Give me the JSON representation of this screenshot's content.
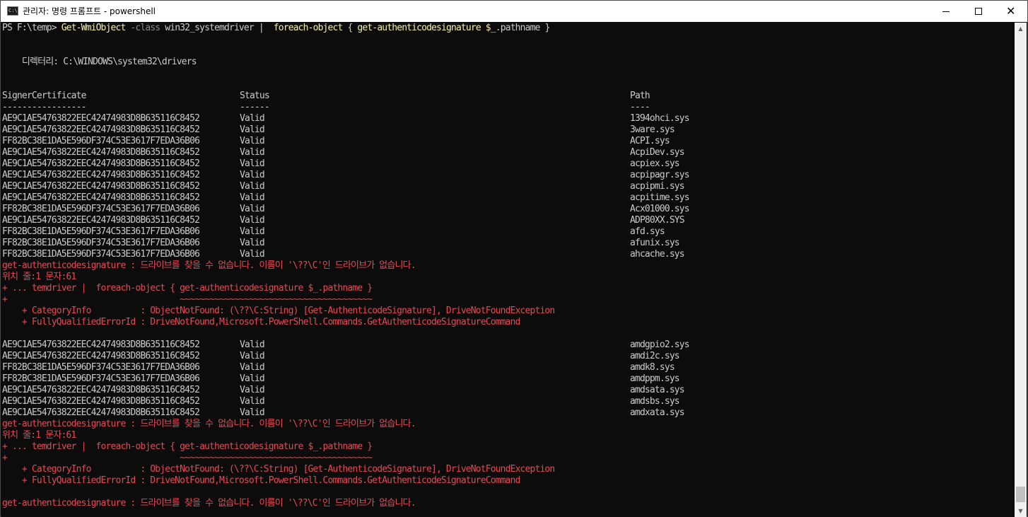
{
  "window": {
    "title": "관리자: 명령 프롬프트 - powershell",
    "icon_text": "C:\\",
    "controls": {
      "minimize": "minimize",
      "maximize": "maximize",
      "close": "✕"
    }
  },
  "console": {
    "prompt": "PS F:\\temp> ",
    "command_part1": "Get-WmiObject",
    "command_param": " -class ",
    "command_part2": "win32_systemdriver",
    "command_pipe": " |  ",
    "command_part3": "foreach-object",
    "command_part4": " { ",
    "command_part5": "get-authenticodesignature",
    "command_var": " $_",
    "command_part6": ".pathname }",
    "directory_line": "    디렉터리: C:\\WINDOWS\\system32\\drivers",
    "headers": {
      "cert": "SignerCertificate",
      "status": "Status",
      "path": "Path"
    },
    "underlines": {
      "cert": "-----------------",
      "status": "------",
      "path": "----"
    },
    "rows_a": [
      {
        "cert": "AE9C1AE54763822EEC42474983D8B635116C8452",
        "status": "Valid",
        "path": "1394ohci.sys"
      },
      {
        "cert": "AE9C1AE54763822EEC42474983D8B635116C8452",
        "status": "Valid",
        "path": "3ware.sys"
      },
      {
        "cert": "FF82BC38E1DA5E596DF374C53E3617F7EDA36B06",
        "status": "Valid",
        "path": "ACPI.sys"
      },
      {
        "cert": "AE9C1AE54763822EEC42474983D8B635116C8452",
        "status": "Valid",
        "path": "AcpiDev.sys"
      },
      {
        "cert": "AE9C1AE54763822EEC42474983D8B635116C8452",
        "status": "Valid",
        "path": "acpiex.sys"
      },
      {
        "cert": "AE9C1AE54763822EEC42474983D8B635116C8452",
        "status": "Valid",
        "path": "acpipagr.sys"
      },
      {
        "cert": "AE9C1AE54763822EEC42474983D8B635116C8452",
        "status": "Valid",
        "path": "acpipmi.sys"
      },
      {
        "cert": "AE9C1AE54763822EEC42474983D8B635116C8452",
        "status": "Valid",
        "path": "acpitime.sys"
      },
      {
        "cert": "FF82BC38E1DA5E596DF374C53E3617F7EDA36B06",
        "status": "Valid",
        "path": "Acx01000.sys"
      },
      {
        "cert": "AE9C1AE54763822EEC42474983D8B635116C8452",
        "status": "Valid",
        "path": "ADP80XX.SYS"
      },
      {
        "cert": "FF82BC38E1DA5E596DF374C53E3617F7EDA36B06",
        "status": "Valid",
        "path": "afd.sys"
      },
      {
        "cert": "FF82BC38E1DA5E596DF374C53E3617F7EDA36B06",
        "status": "Valid",
        "path": "afunix.sys"
      },
      {
        "cert": "FF82BC38E1DA5E596DF374C53E3617F7EDA36B06",
        "status": "Valid",
        "path": "ahcache.sys"
      }
    ],
    "error1": {
      "line1": "get-authenticodesignature : 드라이브를 찾을 수 없습니다. 이름이 '\\??\\C'인 드라이브가 없습니다.",
      "line2": "위치 줄:1 문자:61",
      "line3": "+ ... temdriver |  foreach-object { get-authenticodesignature $_.pathname }",
      "line4": "+                                   ~~~~~~~~~~~~~~~~~~~~~~~~~~~~~~~~~~~~~~~",
      "line5": "    + CategoryInfo          : ObjectNotFound: (\\??\\C:String) [Get-AuthenticodeSignature], DriveNotFoundException",
      "line6": "    + FullyQualifiedErrorId : DriveNotFound,Microsoft.PowerShell.Commands.GetAuthenticodeSignatureCommand"
    },
    "rows_b": [
      {
        "cert": "AE9C1AE54763822EEC42474983D8B635116C8452",
        "status": "Valid",
        "path": "amdgpio2.sys"
      },
      {
        "cert": "AE9C1AE54763822EEC42474983D8B635116C8452",
        "status": "Valid",
        "path": "amdi2c.sys"
      },
      {
        "cert": "FF82BC38E1DA5E596DF374C53E3617F7EDA36B06",
        "status": "Valid",
        "path": "amdk8.sys"
      },
      {
        "cert": "FF82BC38E1DA5E596DF374C53E3617F7EDA36B06",
        "status": "Valid",
        "path": "amdppm.sys"
      },
      {
        "cert": "AE9C1AE54763822EEC42474983D8B635116C8452",
        "status": "Valid",
        "path": "amdsata.sys"
      },
      {
        "cert": "AE9C1AE54763822EEC42474983D8B635116C8452",
        "status": "Valid",
        "path": "amdsbs.sys"
      },
      {
        "cert": "AE9C1AE54763822EEC42474983D8B635116C8452",
        "status": "Valid",
        "path": "amdxata.sys"
      }
    ],
    "error2": {
      "line1": "get-authenticodesignature : 드라이브를 찾을 수 없습니다. 이름이 '\\??\\C'인 드라이브가 없습니다.",
      "line2": "위치 줄:1 문자:61",
      "line3": "+ ... temdriver |  foreach-object { get-authenticodesignature $_.pathname }",
      "line4": "+                                   ~~~~~~~~~~~~~~~~~~~~~~~~~~~~~~~~~~~~~~~",
      "line5": "    + CategoryInfo          : ObjectNotFound: (\\??\\C:String) [Get-AuthenticodeSignature], DriveNotFoundException",
      "line6": "    + FullyQualifiedErrorId : DriveNotFound,Microsoft.PowerShell.Commands.GetAuthenticodeSignatureCommand"
    },
    "error3_line1": "get-authenticodesignature : 드라이브를 찾을 수 없습니다. 이름이 '\\??\\C'인 드라이브가 없습니다."
  },
  "colors": {
    "background": "#0c0c0c",
    "foreground": "#cccccc",
    "command_yellow": "#f9f1a5",
    "param_gray": "#8a8a8a",
    "error_red": "#e74856"
  },
  "scrollbar": {
    "up": "▲",
    "down": "▼"
  }
}
